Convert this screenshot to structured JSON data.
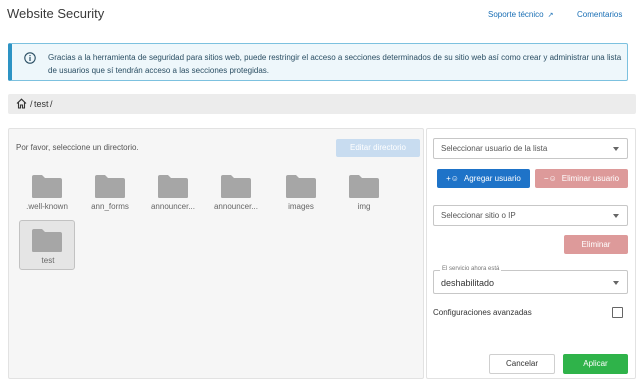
{
  "header": {
    "title": "Website Security",
    "support_link": "Soporte técnico",
    "comments_link": "Comentarios"
  },
  "info": {
    "text": "Gracias a la herramienta de seguridad para sitios web, puede restringir el acceso a secciones determinados de su sitio web así como crear y administrar una lista de usuarios que sí tendrán acceso a las secciones protegidas."
  },
  "breadcrumb": {
    "items": [
      "/",
      "test",
      "/"
    ]
  },
  "left": {
    "prompt": "Por favor, seleccione un directorio.",
    "edit_button": "Editar directorio",
    "folders": [
      {
        "label": ".well-known",
        "selected": false
      },
      {
        "label": "ann_forms",
        "selected": false
      },
      {
        "label": "announcer...",
        "selected": false
      },
      {
        "label": "announcer...",
        "selected": false
      },
      {
        "label": "images",
        "selected": false
      },
      {
        "label": "img",
        "selected": false
      },
      {
        "label": "test",
        "selected": true
      }
    ]
  },
  "right": {
    "user_select_placeholder": "Seleccionar usuario de la lista",
    "add_user_button": "Agregar usuario",
    "remove_user_button": "Eliminar usuario",
    "site_select_placeholder": "Seleccionar sitio o IP",
    "remove_button": "Eliminar",
    "status_legend": "El servicio ahora está",
    "status_value": "deshabilitado",
    "advanced_label": "Configuraciones avanzadas",
    "advanced_checked": false,
    "cancel_button": "Cancelar",
    "apply_button": "Aplicar"
  },
  "icons": {
    "info": "info-icon",
    "home": "home-icon",
    "external": "external-link-icon",
    "folder": "folder-icon",
    "add_user": "add-user-icon",
    "remove_user": "remove-user-icon",
    "caret": "chevron-down-icon"
  },
  "colors": {
    "accent": "#1e73c8",
    "danger_disabled": "#dd9a9a",
    "success": "#2fb34a",
    "info_border": "#2d93c4",
    "folder": "#a6a6a6"
  }
}
